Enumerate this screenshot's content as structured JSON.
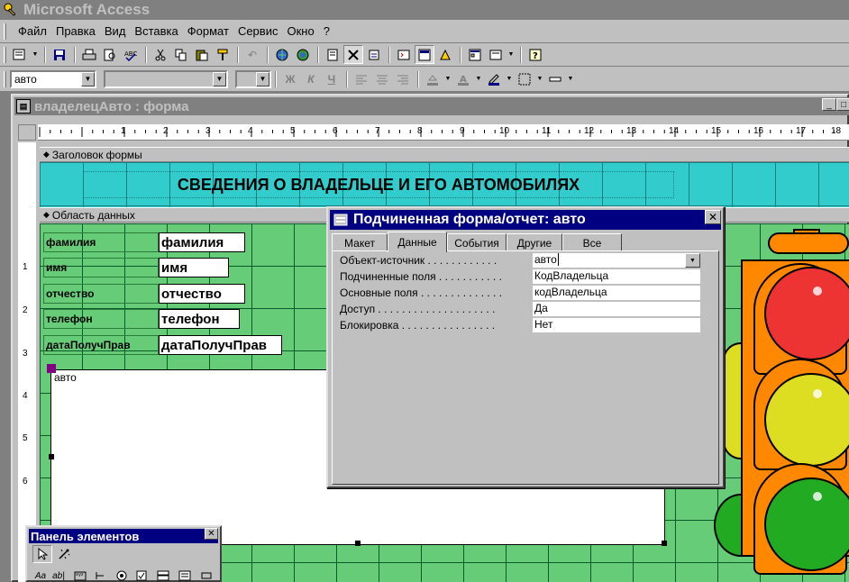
{
  "app": {
    "title": "Microsoft Access"
  },
  "menu": [
    "Файл",
    "Правка",
    "Вид",
    "Вставка",
    "Формат",
    "Сервис",
    "Окно",
    "?"
  ],
  "format_toolbar": {
    "object_combo": "авто",
    "bold": "Ж",
    "italic": "К",
    "underline": "Ч"
  },
  "form_window": {
    "title": "владелецАвто : форма"
  },
  "ruler": {
    "h": [
      "1",
      "2",
      "3",
      "4",
      "5",
      "6",
      "7",
      "8",
      "9",
      "10",
      "11",
      "12",
      "13",
      "14",
      "15",
      "16",
      "17",
      "18"
    ],
    "v": [
      "1",
      "2",
      "3",
      "4",
      "5",
      "6"
    ]
  },
  "sections": {
    "header": "Заголовок формы",
    "detail": "Область данных"
  },
  "header_title": "СВЕДЕНИЯ О ВЛАДЕЛЬЦЕ И ЕГО АВТОМОБИЛЯХ",
  "fields": [
    {
      "label": "фамилия",
      "control": "фамилия"
    },
    {
      "label": "имя",
      "control": "имя"
    },
    {
      "label": "отчество",
      "control": "отчество"
    },
    {
      "label": "телефон",
      "control": "телефон"
    },
    {
      "label": "датаПолучПрав",
      "control": "датаПолучПрав"
    }
  ],
  "subform": {
    "label": "авто"
  },
  "properties": {
    "title": "Подчиненная форма/отчет: авто",
    "tabs": [
      "Макет",
      "Данные",
      "События",
      "Другие",
      "Все"
    ],
    "active_tab": "Данные",
    "rows": [
      {
        "label": "Объект-источник . . . . . . . . . . . .",
        "value": "авто"
      },
      {
        "label": "Подчиненные поля . . . . . . . . . . .",
        "value": "КодВладельца"
      },
      {
        "label": "Основные поля . . . . . . . . . . . . . .",
        "value": "кодВладельца"
      },
      {
        "label": "Доступ . . . . . . . . . . . . . . . . . . . .",
        "value": "Да"
      },
      {
        "label": "Блокировка . . . . . . . . . . . . . . . .",
        "value": "Нет"
      }
    ]
  },
  "toolbox": {
    "title": "Панель элементов"
  },
  "colors": {
    "header_band": "#33cccc",
    "data_band": "#66cc77",
    "title_active": "#000080",
    "light_red": "#ee3333",
    "light_yellow": "#dddd22",
    "light_green": "#22aa22"
  }
}
